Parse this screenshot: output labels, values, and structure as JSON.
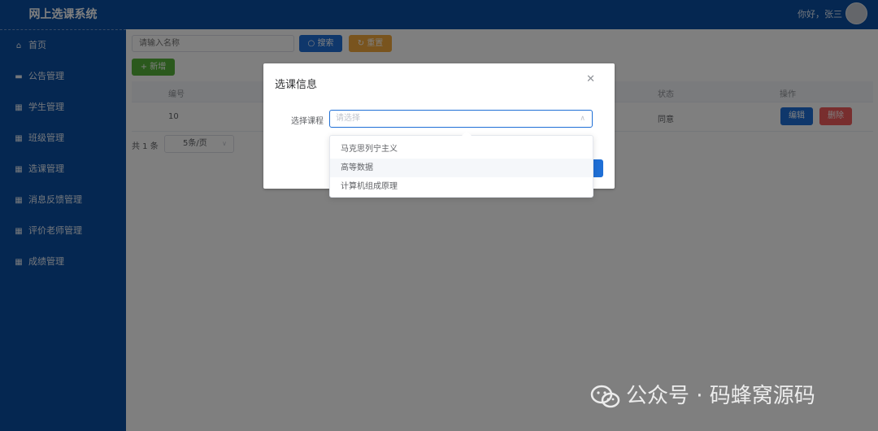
{
  "header": {
    "app_title": "网上选课系统",
    "greeting": "你好，张三"
  },
  "sidebar": {
    "items": [
      {
        "label": "首页",
        "icon": "home-icon"
      },
      {
        "label": "公告管理",
        "icon": "notice-icon"
      },
      {
        "label": "学生管理",
        "icon": "grid-icon"
      },
      {
        "label": "班级管理",
        "icon": "grid-icon"
      },
      {
        "label": "选课管理",
        "icon": "grid-icon"
      },
      {
        "label": "消息反馈管理",
        "icon": "grid-icon"
      },
      {
        "label": "评价老师管理",
        "icon": "grid-icon"
      },
      {
        "label": "成绩管理",
        "icon": "grid-icon"
      }
    ]
  },
  "toolbar": {
    "search_placeholder": "请输入名称",
    "search_label": "搜索",
    "reset_label": "重置",
    "add_label": "新增"
  },
  "table": {
    "columns": {
      "id": "编号",
      "status": "状态",
      "actions": "操作"
    },
    "rows": [
      {
        "id": "10",
        "status": "同意",
        "edit": "编辑",
        "delete": "删除"
      }
    ]
  },
  "pagination": {
    "total": "共 1 条",
    "page_size": "5条/页"
  },
  "dialog": {
    "title": "选课信息",
    "field_label": "选择课程",
    "select_placeholder": "请选择",
    "options": [
      "马克思列宁主义",
      "高等数据",
      "计算机组成原理"
    ],
    "hovered_index": 1
  },
  "watermark": {
    "text": "公众号 · 码蜂窝源码"
  },
  "colors": {
    "primary": "#1f6fd6",
    "sidebar": "#0a4ea3",
    "warning": "#f3a93c",
    "success": "#57b33a",
    "danger": "#f15c5c"
  }
}
